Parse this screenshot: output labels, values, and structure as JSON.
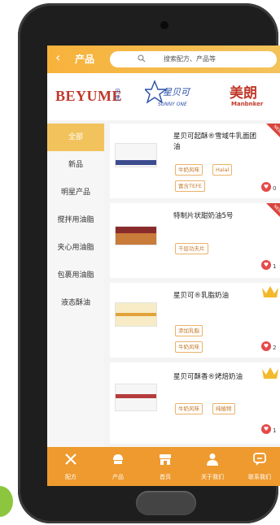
{
  "header": {
    "back_glyph": "‹",
    "title": "产品",
    "search_placeholder": "搜索配方、产品等"
  },
  "brands": {
    "beyume": "BEYUME",
    "beyume_cn": "贝优",
    "sunny_cn": "星贝可",
    "sunny_en": "SUNNY ONE",
    "meilang_cn": "美朗",
    "meilang_en": "Manbnker"
  },
  "sidebar": {
    "items": [
      {
        "label": "全部",
        "active": true
      },
      {
        "label": "新品",
        "active": false
      },
      {
        "label": "明星产品",
        "active": false
      },
      {
        "label": "搅拌用油脂",
        "active": false
      },
      {
        "label": "夹心用油脂",
        "active": false
      },
      {
        "label": "包裹用油脂",
        "active": false
      },
      {
        "label": "液态酥油",
        "active": false
      }
    ]
  },
  "products": [
    {
      "name": "星贝可起酥®雪域牛乳面团油",
      "tags": [
        "牛奶风味",
        "Halal",
        "富含TEFE"
      ],
      "likes": "0",
      "badge": "NEW"
    },
    {
      "name": "特制片状甜奶油5号",
      "tags": [
        "千层功夫片"
      ],
      "likes": "1",
      "badge": "NEW"
    },
    {
      "name": "星贝可®乳脂奶油",
      "tags": [
        "添加乳脂",
        "牛奶风味"
      ],
      "likes": "2",
      "badge": "crown"
    },
    {
      "name": "星贝可酥香®烤焙奶油",
      "tags": [
        "牛奶风味",
        "纯植物"
      ],
      "likes": "1",
      "badge": "crown"
    }
  ],
  "bottom_nav": [
    {
      "label": "配方",
      "icon": "fork-knife-icon"
    },
    {
      "label": "产品",
      "icon": "cake-icon"
    },
    {
      "label": "首页",
      "icon": "shop-icon"
    },
    {
      "label": "关于我们",
      "icon": "user-icon"
    },
    {
      "label": "联系我们",
      "icon": "chat-icon"
    }
  ],
  "colors": {
    "header": "#f7b23b",
    "nav": "#ee9a2e",
    "tag_border": "#e9b26a",
    "heart": "#e54a4a",
    "ribbon": "#d9443c",
    "crown": "#f3b92c"
  }
}
